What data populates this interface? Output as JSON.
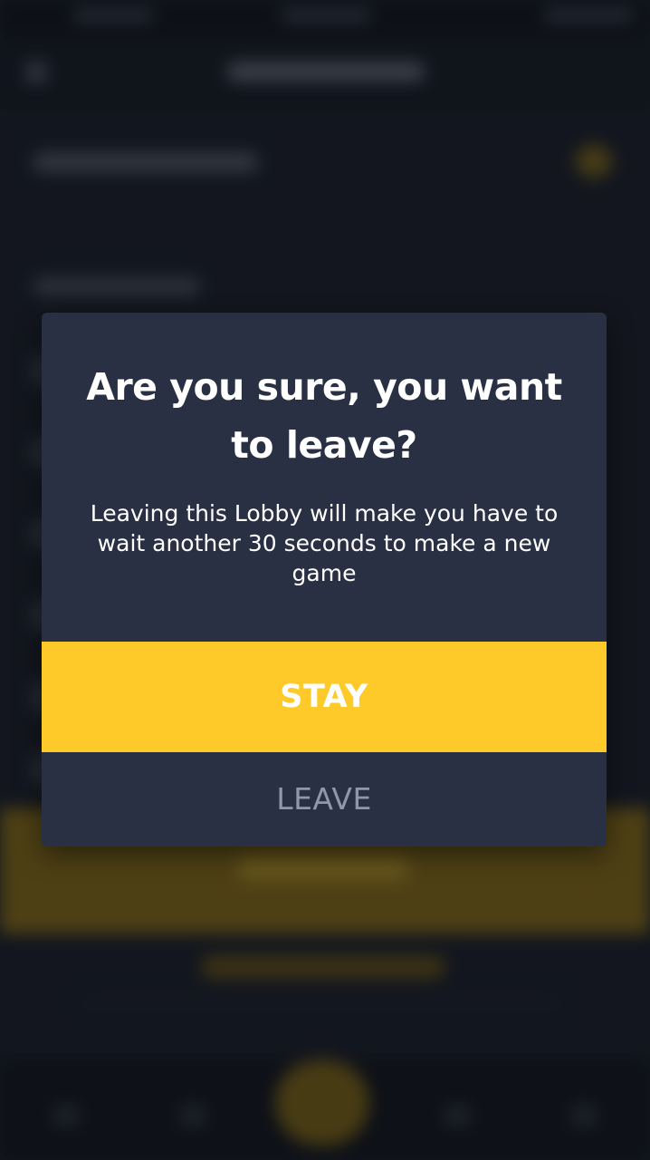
{
  "dialog": {
    "title": "Are you sure, you want to leave?",
    "message": "Leaving this Lobby will make you have to wait another 30 seconds to make a new game",
    "stay_label": "STAY",
    "leave_label": "LEAVE"
  },
  "colors": {
    "dialog_background": "#293044",
    "accent_yellow": "#fdca2a",
    "leave_text": "#8e97ad",
    "backdrop": "#1a1e28"
  }
}
